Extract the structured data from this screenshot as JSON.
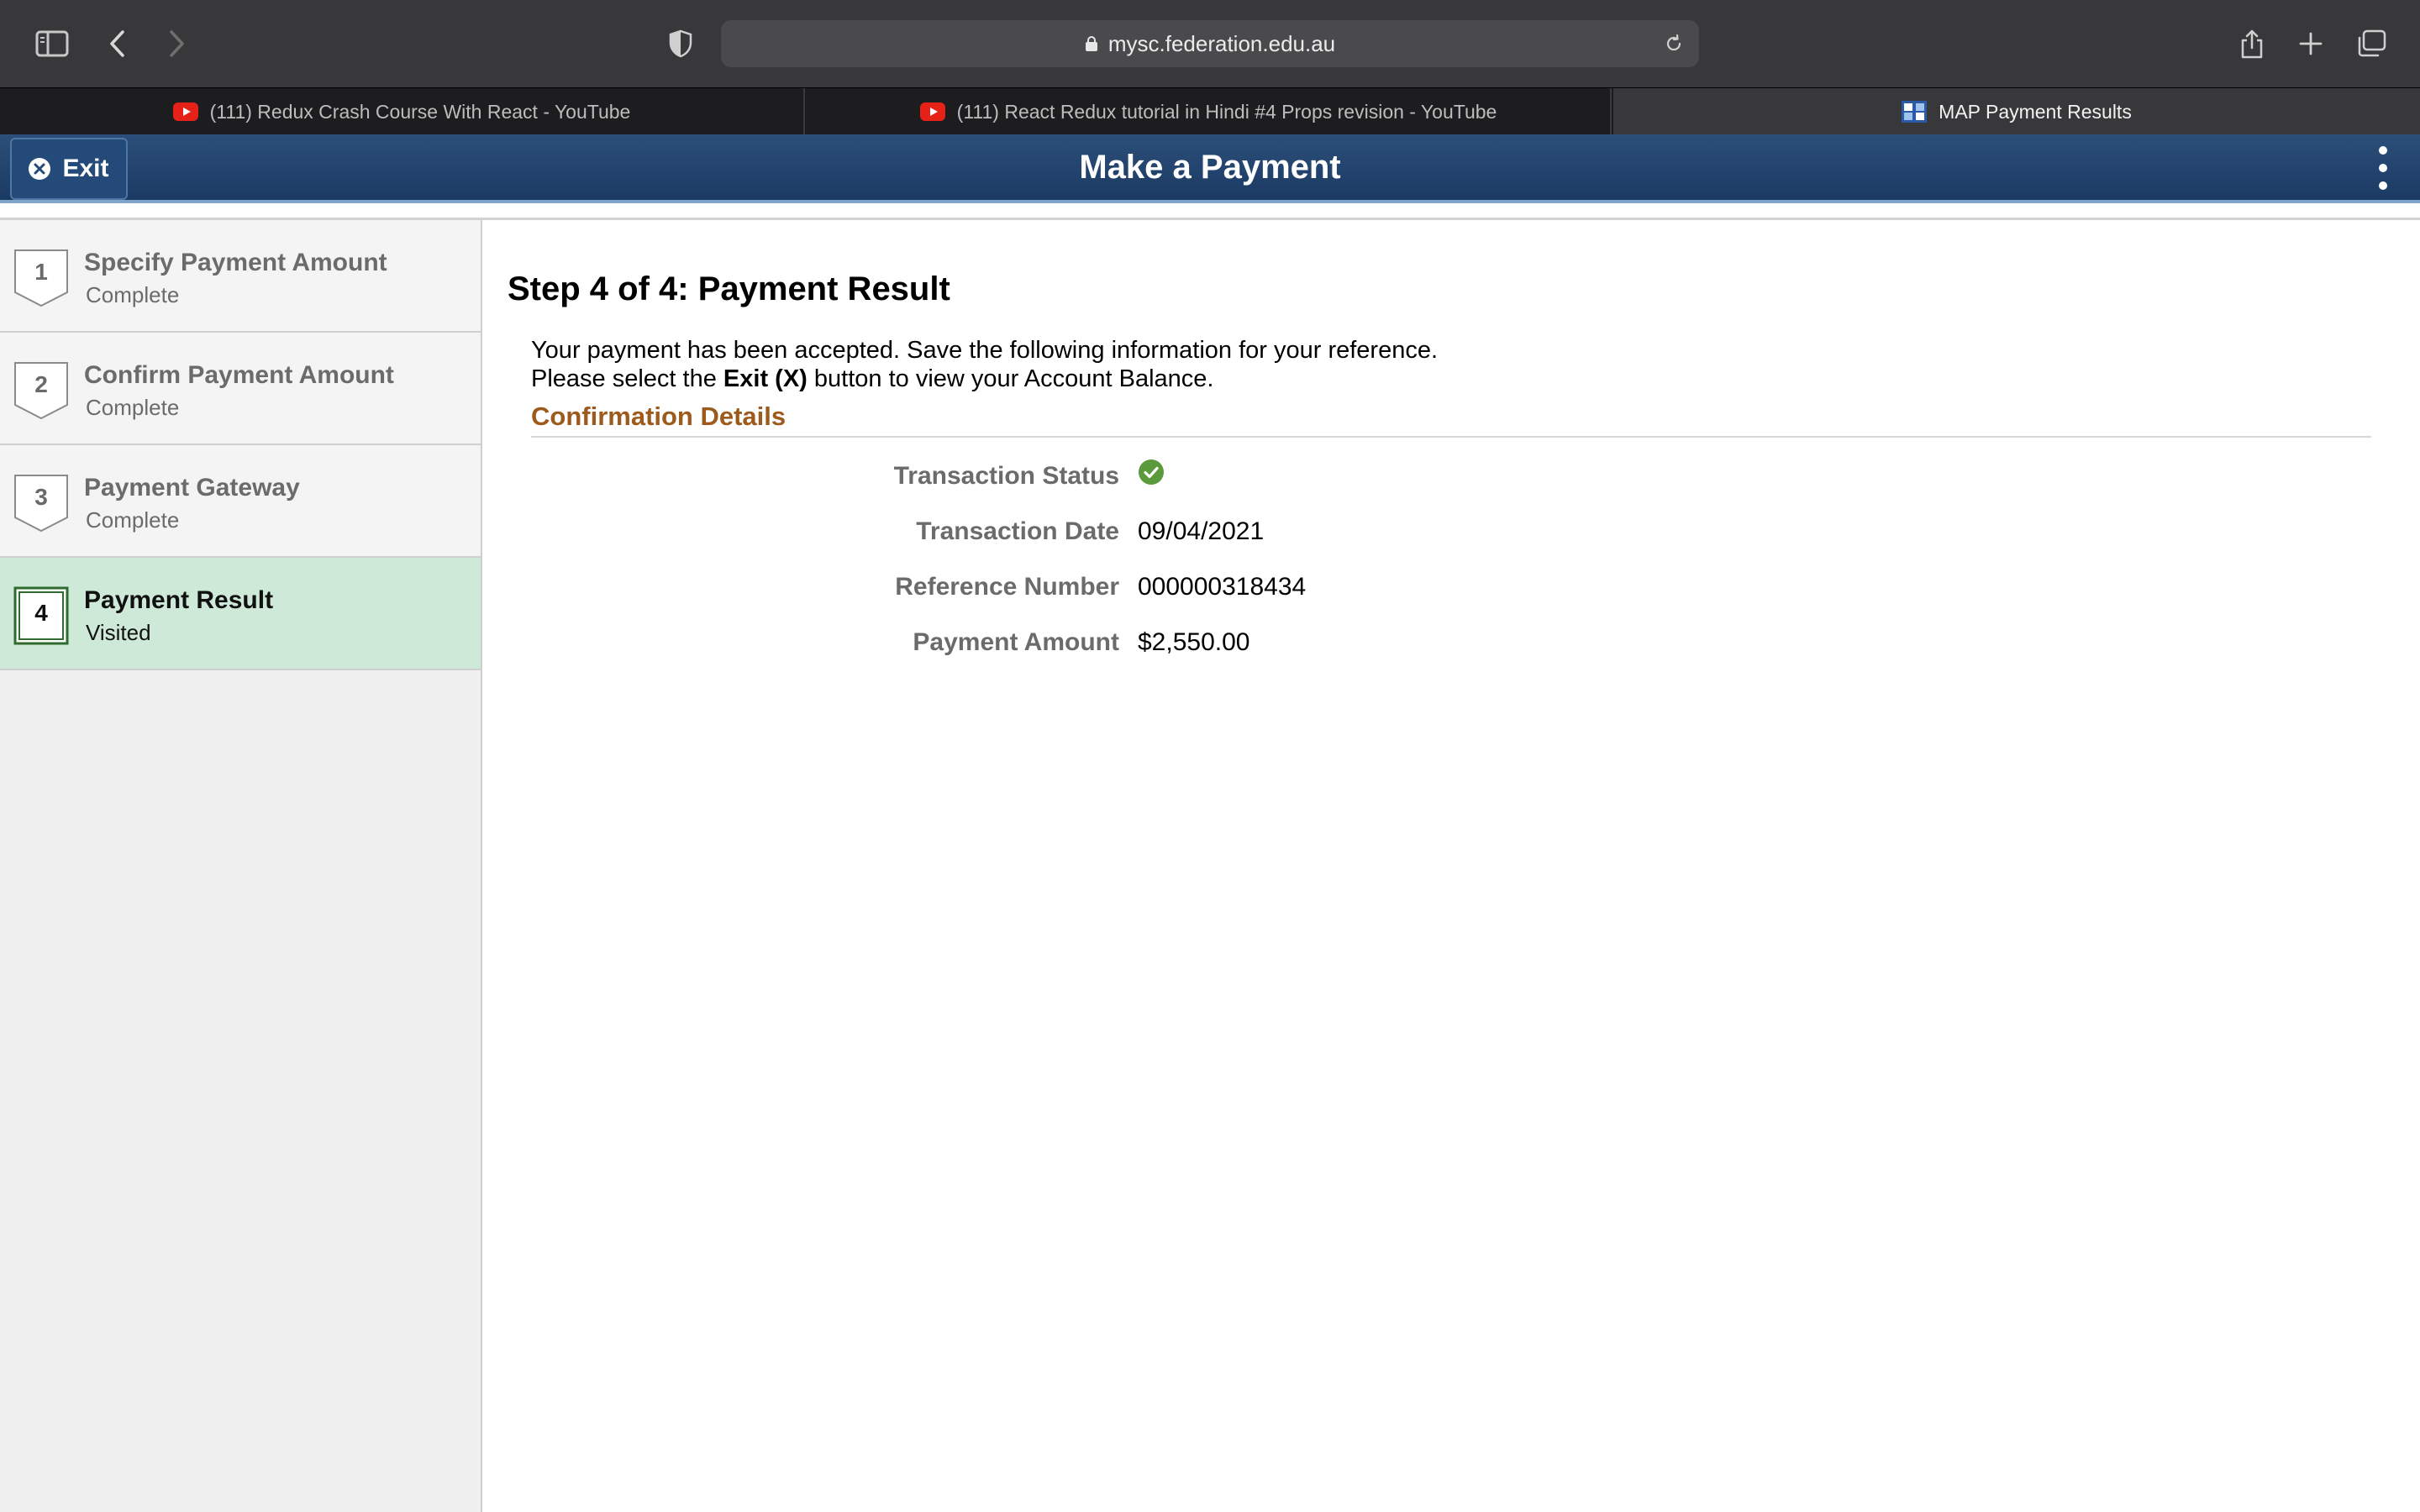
{
  "browser": {
    "url": "mysc.federation.edu.au",
    "tabs": [
      {
        "label": "(111) Redux Crash Course With React - YouTube",
        "icon": "youtube-icon",
        "active": false
      },
      {
        "label": "(111) React Redux tutorial in Hindi #4 Props revision - YouTube",
        "icon": "youtube-icon",
        "active": false
      },
      {
        "label": "MAP Payment Results",
        "icon": "site-favicon",
        "active": true
      }
    ]
  },
  "header": {
    "title": "Make a Payment",
    "exit_label": "Exit"
  },
  "steps": [
    {
      "number": "1",
      "title": "Specify Payment Amount",
      "status": "Complete"
    },
    {
      "number": "2",
      "title": "Confirm Payment Amount",
      "status": "Complete"
    },
    {
      "number": "3",
      "title": "Payment Gateway",
      "status": "Complete"
    },
    {
      "number": "4",
      "title": "Payment Result",
      "status": "Visited"
    }
  ],
  "main": {
    "title": "Step 4 of 4: Payment Result",
    "message_line1": "Your payment has been accepted. Save the following information for your reference.",
    "message_line2_pre": "Please select the ",
    "message_line2_bold": "Exit (X)",
    "message_line2_post": " button to view your Account Balance.",
    "section_title": "Confirmation Details",
    "fields": {
      "status_label": "Transaction Status",
      "date_label": "Transaction Date",
      "date_value": "09/04/2021",
      "reference_label": "Reference Number",
      "reference_value": "000000318434",
      "amount_label": "Payment Amount",
      "amount_value": "$2,550.00"
    }
  },
  "colors": {
    "header": "#1b3a63",
    "active_step": "#cfe9d8",
    "section_title": "#9c5a1c",
    "success": "#5a9a3a"
  }
}
